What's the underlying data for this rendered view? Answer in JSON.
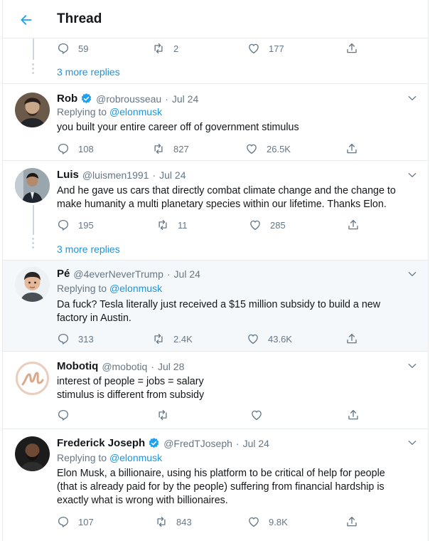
{
  "header": {
    "title": "Thread"
  },
  "top_actions": {
    "replies": "59",
    "retweets": "2",
    "likes": "177"
  },
  "more_replies_1": "3 more replies",
  "more_replies_2": "3 more replies",
  "replying_to_prefix": "Replying to",
  "tweets": [
    {
      "name": "Rob",
      "verified": true,
      "handle": "@robrousseau",
      "date": "Jul 24",
      "replying_to": "@elonmusk",
      "text_lines": [
        "you built your entire career off of government stimulus"
      ],
      "replies": "108",
      "retweets": "827",
      "likes": "26.5K"
    },
    {
      "name": "Luis",
      "verified": false,
      "handle": "@luismen1991",
      "date": "Jul 24",
      "replying_to": "",
      "text_lines": [
        "And he gave us cars that directly combat climate change and the change to",
        "make humanity a multi planetary species within our lifetime. Thanks Elon."
      ],
      "replies": "195",
      "retweets": "11",
      "likes": "285"
    },
    {
      "name": "Pé",
      "verified": false,
      "handle": "@4everNeverTrump",
      "date": "Jul 24",
      "replying_to": "@elonmusk",
      "text_lines": [
        "Da fuck? Tesla literally just received a $15 million subsidy to build a new",
        "factory in Austin."
      ],
      "replies": "313",
      "retweets": "2.4K",
      "likes": "43.6K"
    },
    {
      "name": "Mobotiq",
      "verified": false,
      "handle": "@mobotiq",
      "date": "Jul 28",
      "replying_to": "",
      "text_lines": [
        "interest of people = jobs = salary",
        "stimulus is different from subsidy"
      ],
      "replies": "",
      "retweets": "",
      "likes": ""
    },
    {
      "name": "Frederick Joseph",
      "verified": true,
      "handle": "@FredTJoseph",
      "date": "Jul 24",
      "replying_to": "@elonmusk",
      "text_lines": [
        "Elon Musk, a billionaire, using his platform to be critical of help for people",
        "(that is already paid for by the people) suffering from financial hardship is",
        "exactly what is wrong with billionaires."
      ],
      "replies": "107",
      "retweets": "843",
      "likes": "9.8K"
    }
  ],
  "dot_sep": "·",
  "colors": {
    "accent": "#1b95e0",
    "muted": "#657786",
    "border": "#e6ecf0",
    "highlight": "#f5f8fa"
  },
  "icons": [
    "back-arrow-icon",
    "reply-icon",
    "retweet-icon",
    "like-icon",
    "share-icon",
    "verified-badge-icon",
    "chevron-down-icon"
  ]
}
